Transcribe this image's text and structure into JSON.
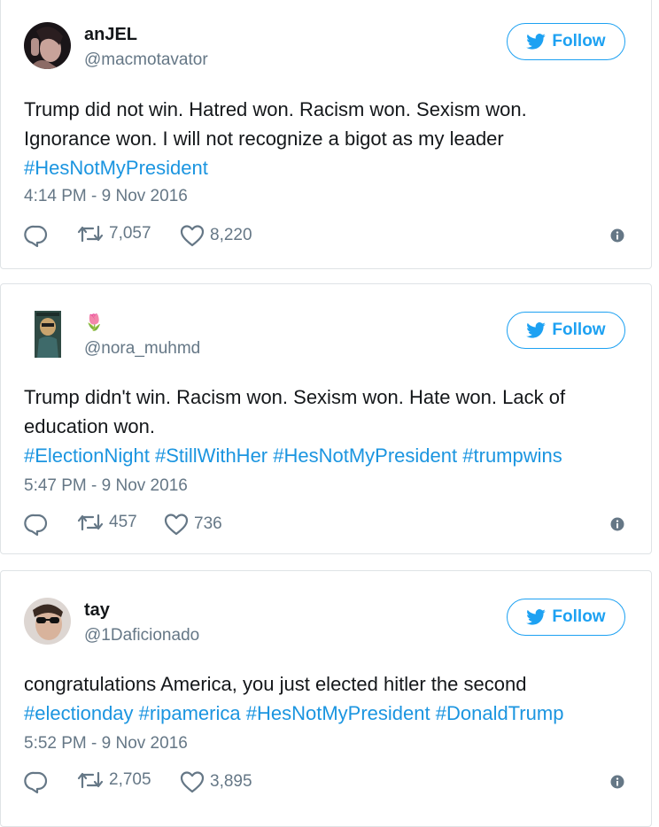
{
  "follow_label": "Follow",
  "tweets": [
    {
      "name": "anJEL",
      "handle": "@macmotavator",
      "text_lines": [
        "Trump did not win. Hatred won. Racism won. Sexism won.",
        "Ignorance won. I will not recognize a bigot as my leader"
      ],
      "hashtags": [
        "#HesNotMyPresident"
      ],
      "timestamp": "4:14 PM - 9 Nov 2016",
      "retweets": "7,057",
      "likes": "8,220"
    },
    {
      "name": "🌷",
      "handle": "@nora_muhmd",
      "text_lines": [
        "Trump didn't win. Racism won. Sexism won. Hate won. Lack of",
        "education won."
      ],
      "hashtags": [
        "#ElectionNight",
        "#StillWithHer",
        "#HesNotMyPresident",
        "#trumpwins"
      ],
      "timestamp": "5:47 PM - 9 Nov 2016",
      "retweets": "457",
      "likes": "736"
    },
    {
      "name": "tay",
      "handle": "@1Daficionado",
      "text_lines": [
        "congratulations America, you just elected hitler the second"
      ],
      "hashtags": [
        "#electionday",
        "#ripamerica",
        "#HesNotMyPresident",
        "#DonaldTrump"
      ],
      "timestamp": "5:52 PM - 9 Nov 2016",
      "retweets": "2,705",
      "likes": "3,895"
    }
  ],
  "icons": {
    "bird": "twitter-bird-icon",
    "reply": "reply-icon",
    "retweet": "retweet-icon",
    "like": "heart-icon",
    "info": "info-icon"
  },
  "colors": {
    "accent": "#1da1f2",
    "hashtag": "#1b95e0",
    "secondary_text": "#657786",
    "border": "#dfe3e6"
  }
}
